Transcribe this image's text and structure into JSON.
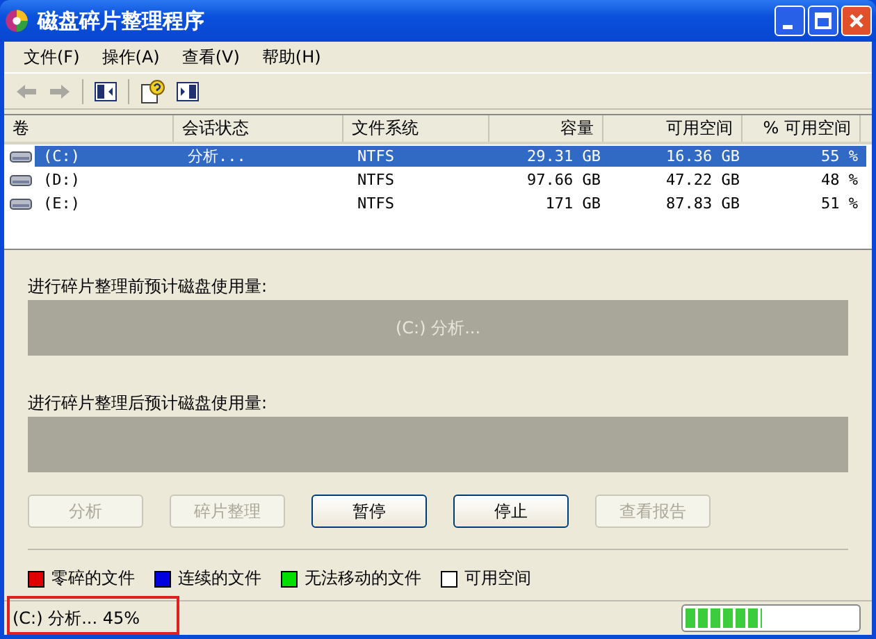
{
  "window": {
    "title": "磁盘碎片整理程序"
  },
  "menu": [
    {
      "label": "文件(F)"
    },
    {
      "label": "操作(A)"
    },
    {
      "label": "查看(V)"
    },
    {
      "label": "帮助(H)"
    }
  ],
  "table": {
    "columns": [
      "卷",
      "会话状态",
      "文件系统",
      "容量",
      "可用空间",
      "% 可用空间"
    ],
    "rows": [
      {
        "selected": true,
        "cells": [
          "(C:)",
          "分析...",
          "NTFS",
          "29.31 GB",
          "16.36 GB",
          "55 %"
        ]
      },
      {
        "selected": false,
        "cells": [
          "(D:)",
          "",
          "NTFS",
          "97.66 GB",
          "47.22 GB",
          "48 %"
        ]
      },
      {
        "selected": false,
        "cells": [
          "(E:)",
          "",
          "NTFS",
          "171 GB",
          "87.83 GB",
          "51 %"
        ]
      }
    ]
  },
  "before_label": "进行碎片整理前预计磁盘使用量:",
  "before_status": "(C:) 分析...",
  "after_label": "进行碎片整理后预计磁盘使用量:",
  "buttons": [
    {
      "label": "分析",
      "disabled": true
    },
    {
      "label": "碎片整理",
      "disabled": true
    },
    {
      "label": "暂停",
      "disabled": false
    },
    {
      "label": "停止",
      "disabled": false
    },
    {
      "label": "查看报告",
      "disabled": true
    }
  ],
  "legend": [
    {
      "label": "零碎的文件",
      "color": "#e00000"
    },
    {
      "label": "连续的文件",
      "color": "#0000e0"
    },
    {
      "label": "无法移动的文件",
      "color": "#00e000"
    },
    {
      "label": "可用空间",
      "color": "#ffffff"
    }
  ],
  "status_bar": {
    "text": "(C:) 分析... 45%",
    "progress": {
      "level": 0.45
    }
  }
}
